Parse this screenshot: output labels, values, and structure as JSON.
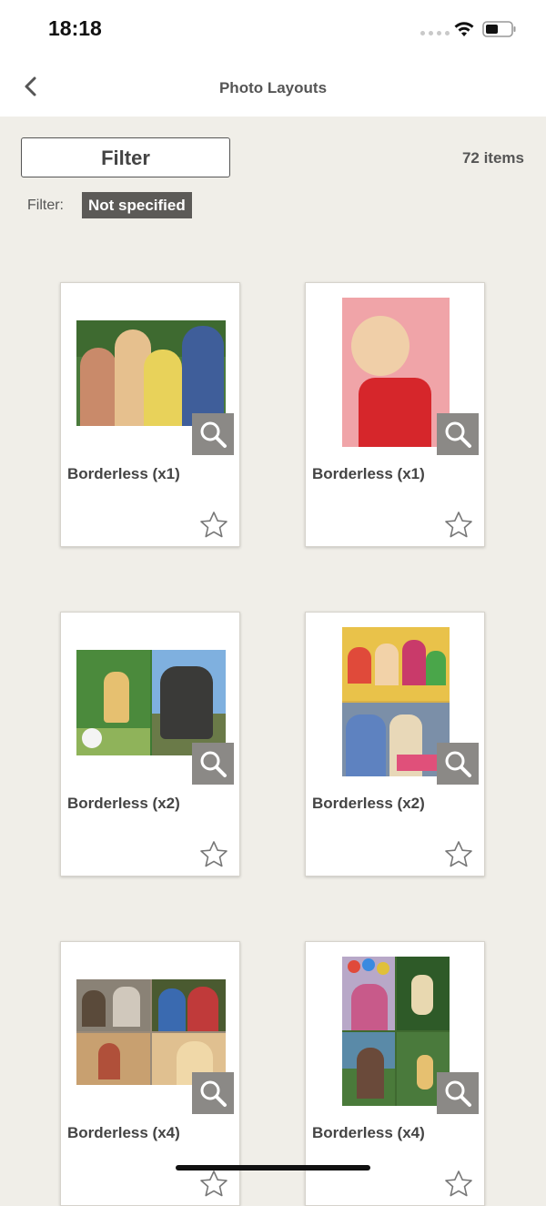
{
  "status": {
    "time": "18:18"
  },
  "nav": {
    "title": "Photo Layouts"
  },
  "filter": {
    "button_label": "Filter",
    "label": "Filter:",
    "value": "Not specified"
  },
  "item_count": "72 items",
  "layouts": [
    {
      "label": "Borderless (x1)"
    },
    {
      "label": "Borderless (x1)"
    },
    {
      "label": "Borderless (x2)"
    },
    {
      "label": "Borderless (x2)"
    },
    {
      "label": "Borderless (x4)"
    },
    {
      "label": "Borderless (x4)"
    }
  ],
  "colors": {
    "background": "#f0eee8",
    "tag_bg": "#5c5a57",
    "zoom_bg": "#8b8986"
  }
}
